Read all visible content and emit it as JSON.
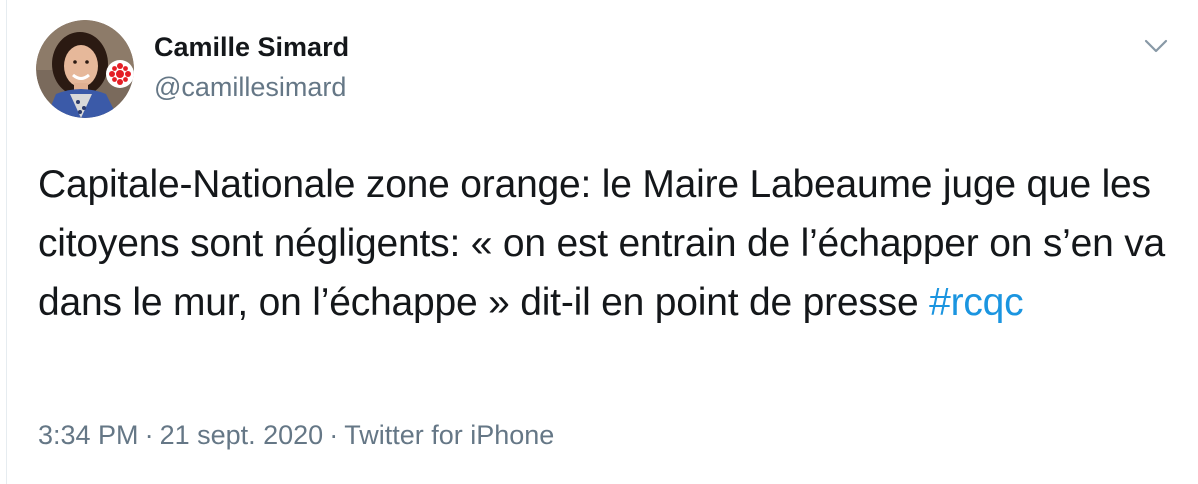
{
  "tweet": {
    "author": {
      "name": "Camille Simard",
      "handle": "@camillesimard",
      "avatar_icon": "profile-photo-with-cbc-gem-badge"
    },
    "menu_icon": "chevron-down-icon",
    "text": "Capitale-Nationale zone orange: le Maire Labeaume juge que les citoyens sont négligents: « on est entrain de l’échapper on s’en va dans le mur, on l’échappe » dit-il en point de presse ",
    "hashtag": "#rcqc",
    "time": "3:34 PM",
    "date": "21 sept. 2020",
    "separator": "·",
    "source": "Twitter for iPhone"
  },
  "colors": {
    "text": "#14171a",
    "secondary": "#657786",
    "link": "#1b95e0",
    "cbc_red": "#e41e26"
  }
}
